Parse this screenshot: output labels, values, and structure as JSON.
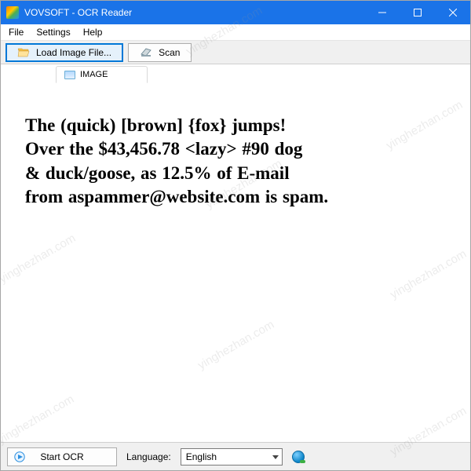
{
  "window": {
    "title": "VOVSOFT - OCR Reader"
  },
  "menubar": {
    "items": [
      "File",
      "Settings",
      "Help"
    ]
  },
  "toolbar": {
    "load_image": "Load Image File...",
    "scan": "Scan"
  },
  "tabs": {
    "image_tab": "IMAGE"
  },
  "content": {
    "line1": "The (quick) [brown] {fox} jumps!",
    "line2": "Over the $43,456.78 <lazy> #90 dog",
    "line3": "& duck/goose, as 12.5% of E-mail",
    "line4": "from aspammer@website.com is spam."
  },
  "statusbar": {
    "start_ocr": "Start OCR",
    "language_label": "Language:",
    "language_value": "English"
  },
  "watermark": "yinghezhan.com"
}
